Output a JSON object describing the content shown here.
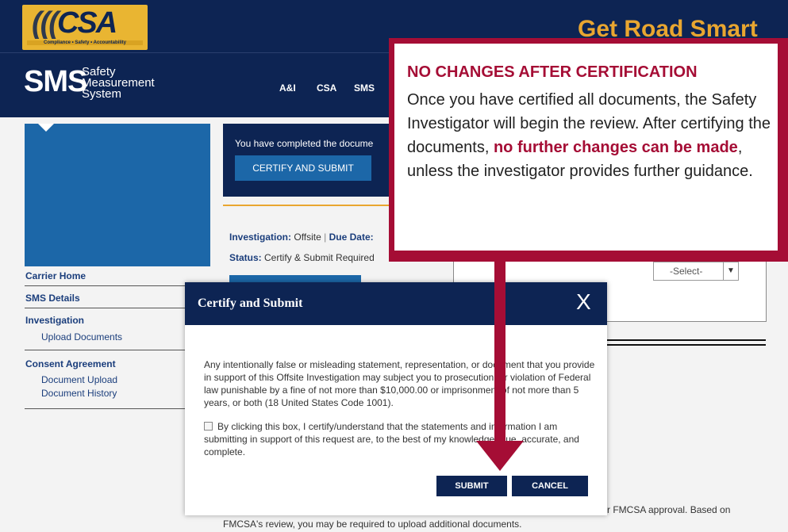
{
  "header": {
    "logo_text": "CSA",
    "logo_tagline": "Compliance • Safety • Accountability",
    "slogan": "Get Road Smart",
    "sms_abbrev": "SMS",
    "sms_full": "Safety Measurement System",
    "nav": [
      "A&I",
      "CSA",
      "SMS"
    ]
  },
  "sidebar": {
    "items": [
      {
        "label": "Carrier Home",
        "sub": []
      },
      {
        "label": "SMS Details",
        "sub": []
      },
      {
        "label": "Investigation",
        "sub": [
          "Upload Documents"
        ]
      },
      {
        "label": "Consent Agreement",
        "sub": [
          "Document Upload",
          "Document History"
        ]
      }
    ]
  },
  "main": {
    "completed_text": "You have completed the docume",
    "certify_button": "CERTIFY AND SUBMIT",
    "investigation_label": "Investigation:",
    "investigation_value": "Offsite",
    "due_date_label": "Due Date:",
    "status_label": "Status:",
    "status_value": "Certify & Submit Required",
    "select_value": "-Select-",
    "footer_right": "r FMCSA approval. Based on",
    "footer_left": "FMCSA's review, you may be required to upload additional documents."
  },
  "modal": {
    "title": "Certify and Submit",
    "close_glyph": "X",
    "warning": "Any intentionally false or misleading statement, representation, or document that you provide in support of this Offsite Investigation may subject you to prosecution for violation of Federal law punishable by a fine of not more than $10,000.00 or imprisonment of not more than 5 years, or both (18 United States Code 1001).",
    "checkbox_label": "By clicking this box, I certify/understand that the statements and information I am submitting in support of this request are, to the best of my knowledge, true, accurate, and complete.",
    "submit": "SUBMIT",
    "cancel": "CANCEL"
  },
  "callout": {
    "title": "NO CHANGES AFTER CERTIFICATION",
    "body_start": "Once you have certified all documents, the Safety Investigator will begin the review. After certifying the documents, ",
    "body_highlight": "no further changes can be made",
    "body_end": ", unless the investigator provides further guidance.",
    "accent_color": "#a50d35"
  },
  "colors": {
    "navy": "#0d2453",
    "blue": "#1c67a8",
    "gold": "#e9b532",
    "callout_red": "#a50d35"
  }
}
